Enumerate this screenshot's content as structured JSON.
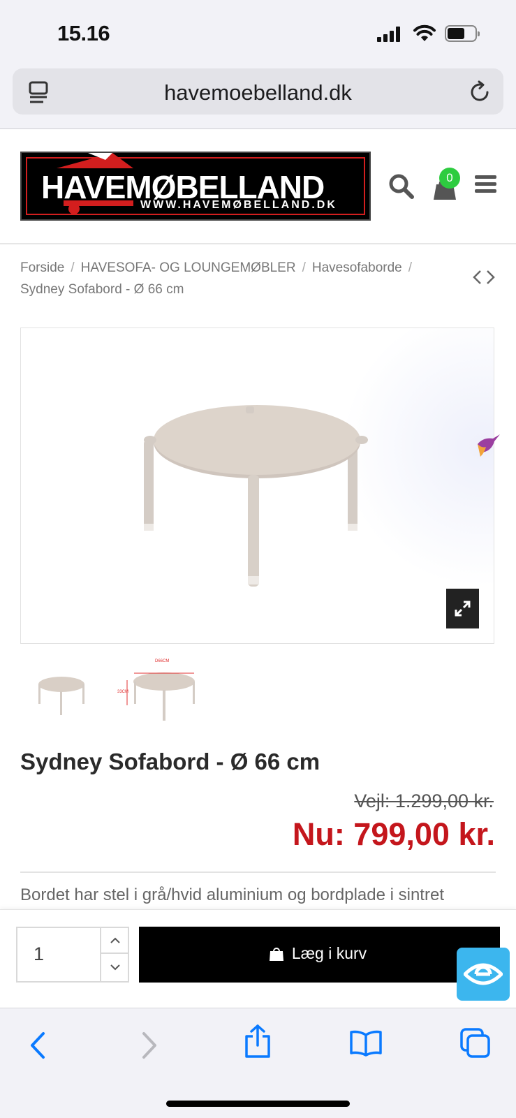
{
  "status_bar": {
    "time": "15.16"
  },
  "browser": {
    "url": "havemoebelland.dk"
  },
  "site": {
    "logo_title": "HAVEMØBELLAND",
    "logo_url": "WWW.HAVEMØBELLAND.DK",
    "cart_count": "0"
  },
  "breadcrumb": {
    "items": [
      "Forside",
      "HAVESOFA- OG LOUNGEMØBLER",
      "Havesofaborde",
      "Sydney Sofabord - Ø 66 cm"
    ]
  },
  "product": {
    "title": "Sydney Sofabord - Ø 66 cm",
    "old_price": "Vejl: 1.299,00 kr.",
    "new_price": "Nu: 799,00 kr.",
    "description": "Bordet har stel i grå/hvid aluminium og bordplade i sintret",
    "thumb_labels": [
      "D66CM",
      "33CM"
    ]
  },
  "cart": {
    "quantity": "1",
    "add_label": "Læg i kurv"
  },
  "colors": {
    "price_red": "#c4161c",
    "logo_red": "#d31e1e",
    "badge_green": "#2ecc40",
    "ios_blue": "#0a7aff",
    "a11y_blue": "#3cb6ee"
  }
}
